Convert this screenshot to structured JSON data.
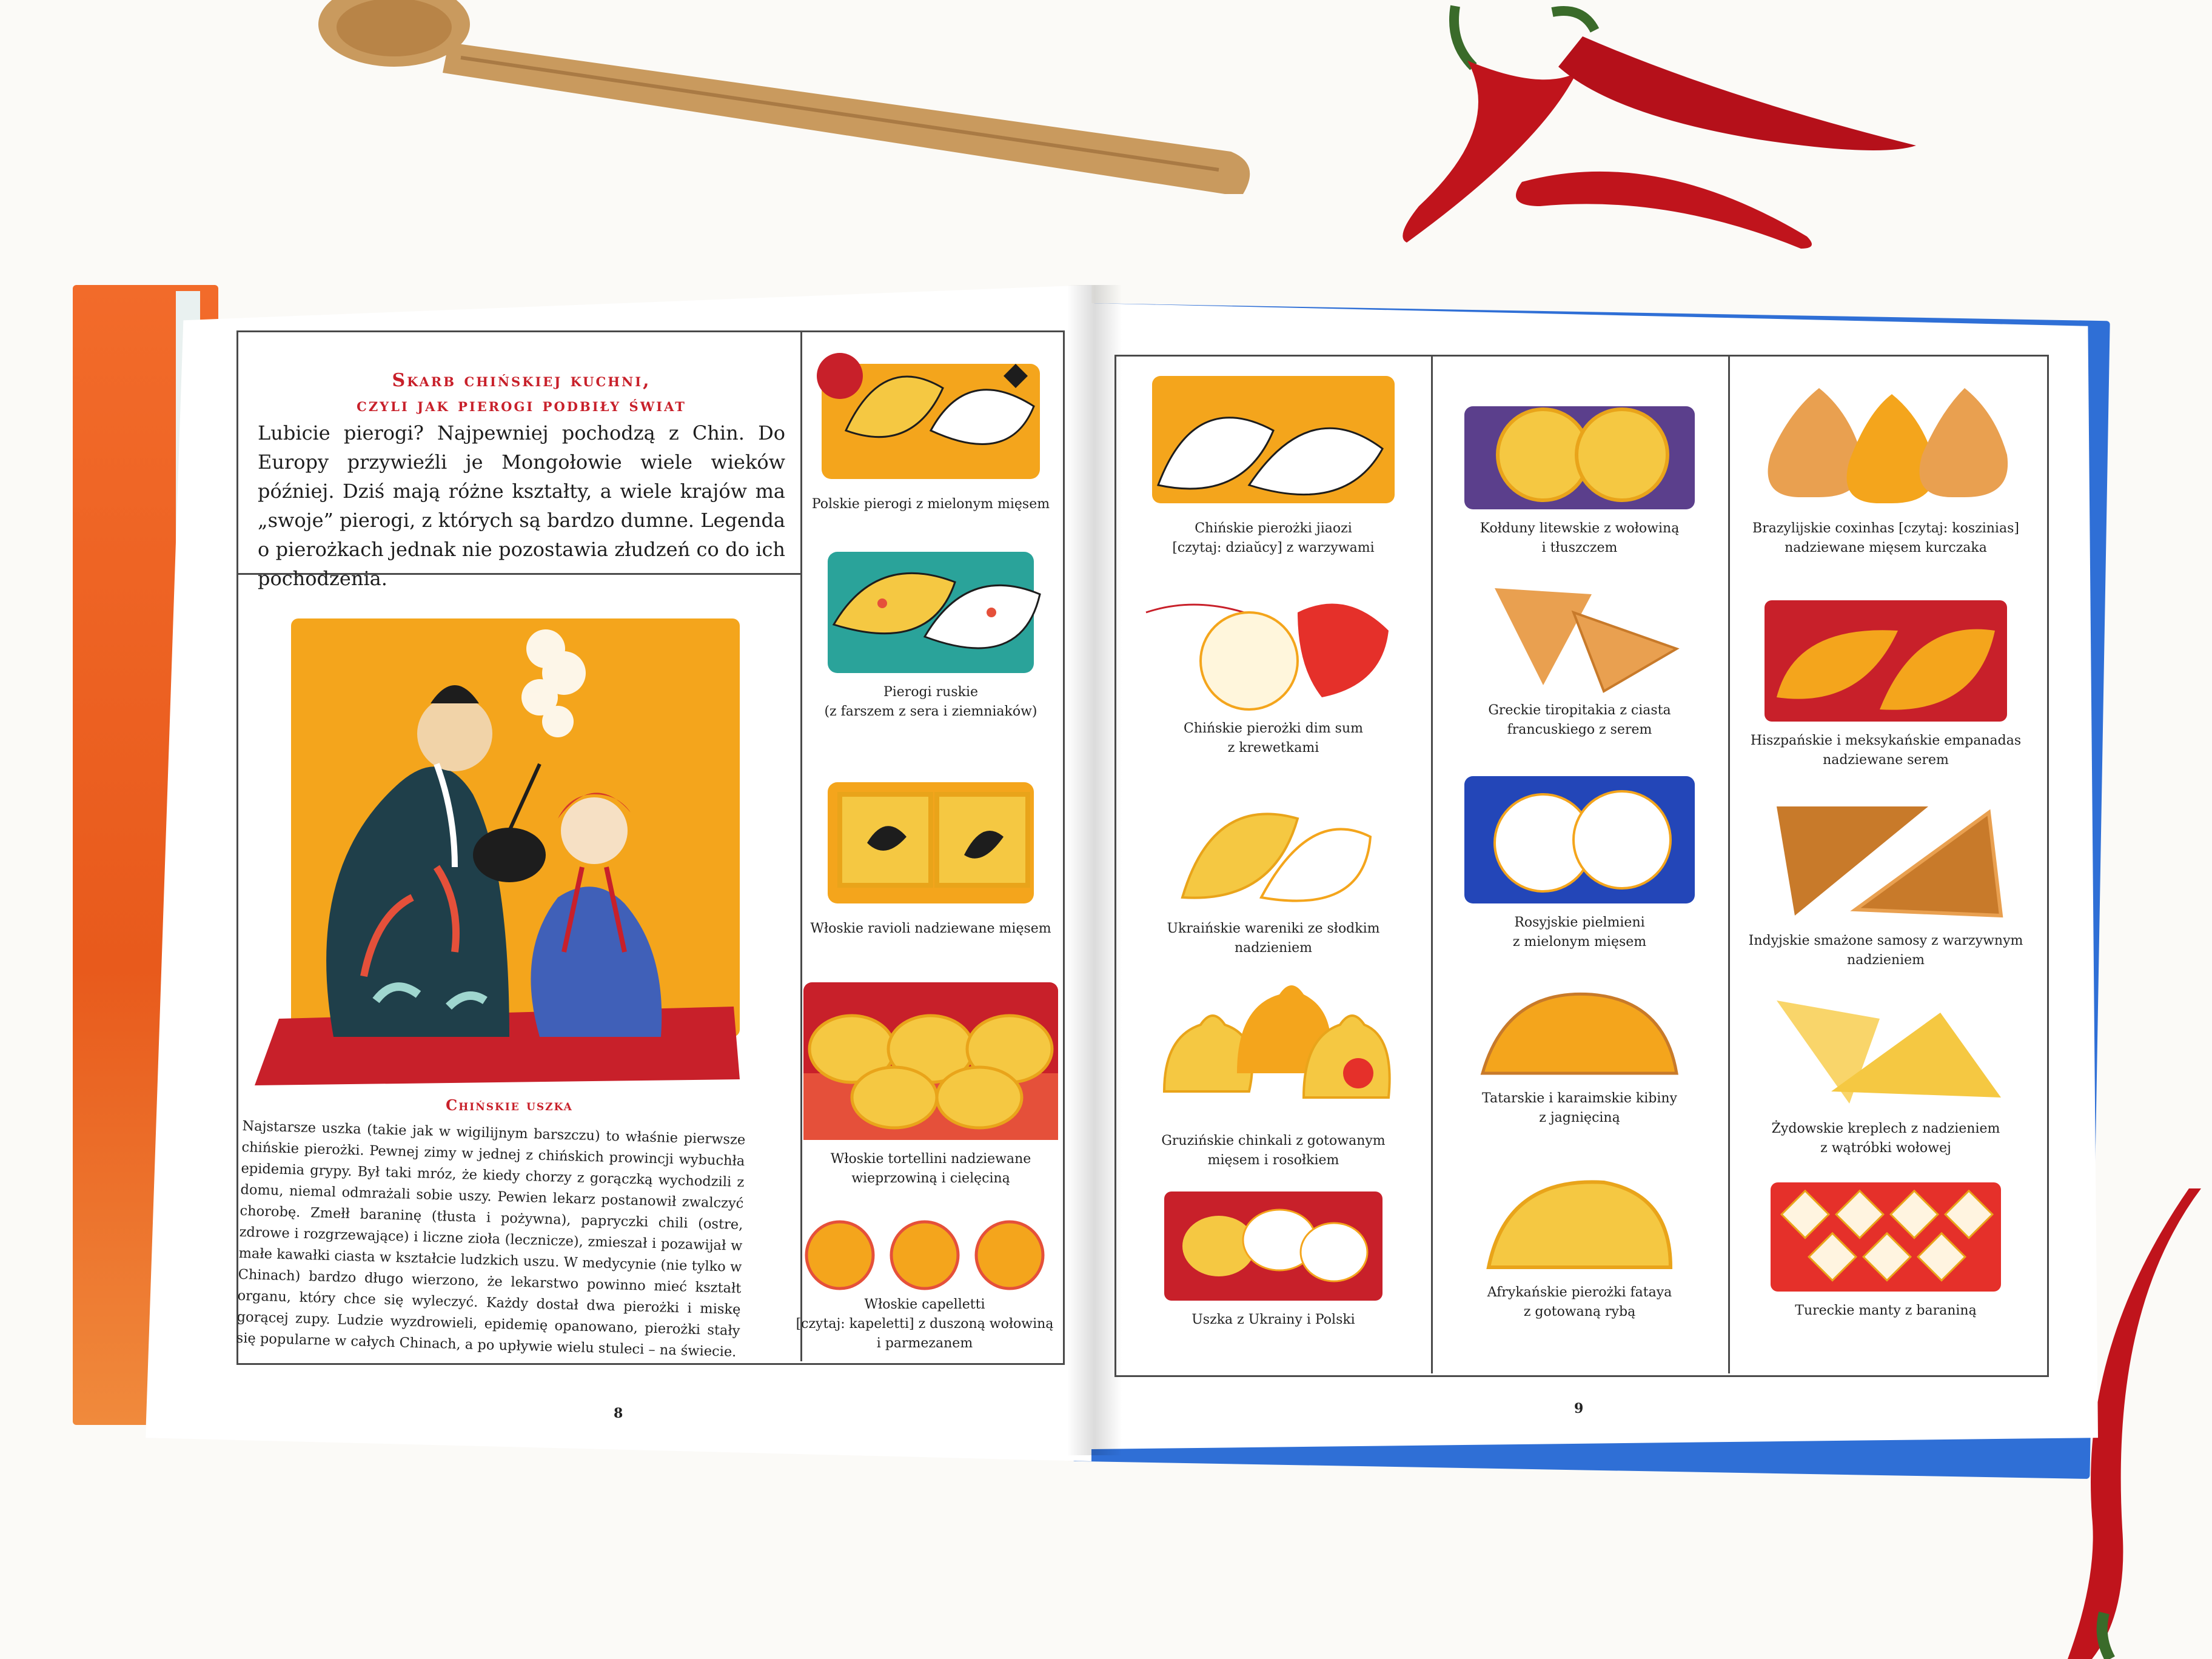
{
  "left_page": {
    "heading_line1": "Skarb chińskiej kuchni,",
    "heading_line2": "czyli jak pierogi podbiły świat",
    "intro": "Lubicie pierogi? Najpewniej pochodzą z Chin. Do Europy przywieźli je Mongołowie wiele wieków później. Dziś mają różne kształty, a wiele krajów ma „swoje” pierogi, z których są bardzo dumne. Legenda o pierożkach jednak nie pozostawia złudzeń co do ich pochodzenia.",
    "story_title": "Chińskie uszka",
    "story": "Najstarsze uszka (takie jak w wigilijnym barszczu) to właśnie pierwsze chińskie pierożki. Pewnej zimy w jednej z chińskich prowincji wybuchła epidemia grypy. Był taki mróz, że kiedy chorzy z gorączką wychodzili z domu, niemal odmrażali sobie uszy. Pewien lekarz postanowił zwalczyć chorobę. Zmełł baraninę (tłusta i pożywna), papryczki chili (ostre, zdrowe i rozgrzewające) i liczne zioła (lecznicze), zmieszał i pozawijał w małe kawałki ciasta w kształcie ludzkich uszu. W medycynie (nie tylko w Chinach) bardzo długo wierzono, że lekarstwo powinno mieć kształt organu, który chce się wyleczyć. Każdy dostał dwa pierożki i miskę gorącej zupy. Ludzie wyzdrowieli, epidemię opanowano, pierożki stały się popularne w całych Chinach, a po upływie wielu stuleci – na świecie.",
    "page_number": "8",
    "dumplings": [
      {
        "caption": "Polskie pierogi z mielonym mięsem"
      },
      {
        "caption": "Pierogi ruskie\n(z farszem z sera i ziemniaków)"
      },
      {
        "caption": "Włoskie ravioli nadziewane mięsem"
      },
      {
        "caption": "Włoskie tortellini nadziewane\nwieprzowiną i cielęciną"
      },
      {
        "caption": "Włoskie capelletti\n[czytaj: kapeletti] z duszoną wołowiną\ni parmezanem"
      }
    ]
  },
  "right_page": {
    "page_number": "9",
    "col1": [
      {
        "caption": "Chińskie pierożki jiaozi\n[czytaj: dziaŭcy] z warzywami"
      },
      {
        "caption": "Chińskie pierożki dim sum\nz krewetkami"
      },
      {
        "caption": "Ukraińskie wareniki ze słodkim\nnadzieniem"
      },
      {
        "caption": "Gruzińskie chinkali z gotowanym\nmięsem i rosołkiem"
      },
      {
        "caption": "Uszka z Ukrainy i Polski"
      }
    ],
    "col2": [
      {
        "caption": "Kołduny litewskie z wołowiną\ni tłuszczem"
      },
      {
        "caption": "Greckie tiropitakia z ciasta\nfrancuskiego z serem"
      },
      {
        "caption": "Rosyjskie pielmieni\nz mielonym mięsem"
      },
      {
        "caption": "Tatarskie i karaimskie kibiny\nz jagnięciną"
      },
      {
        "caption": "Afrykańskie pierożki fataya\nz gotowaną rybą"
      }
    ],
    "col3": [
      {
        "caption": "Brazylijskie coxinhas [czytaj: koszinias]\nnadziewane mięsem kurczaka"
      },
      {
        "caption": "Hiszpańskie i meksykańskie empanadas\nnadziewane serem"
      },
      {
        "caption": "Indyjskie smażone samosy z warzywnym\nnadzieniem"
      },
      {
        "caption": "Żydowskie kreplech z nadzieniem\nz wątróbki wołowej"
      },
      {
        "caption": "Tureckie manty z baraniną"
      }
    ]
  },
  "colors": {
    "heading_red": "#c8202a",
    "dough_yellow": "#f5c842",
    "bg_orange": "#f4a51c",
    "bg_red": "#c8202a",
    "bg_teal": "#2aa39a",
    "bg_purple": "#5b3f8c",
    "bg_blue": "#2346b8",
    "chili_red": "#c0141c",
    "spoon_wood": "#c99a5e",
    "cover_blue": "#2f6fd6",
    "cover_orange": "#f26b2a"
  }
}
